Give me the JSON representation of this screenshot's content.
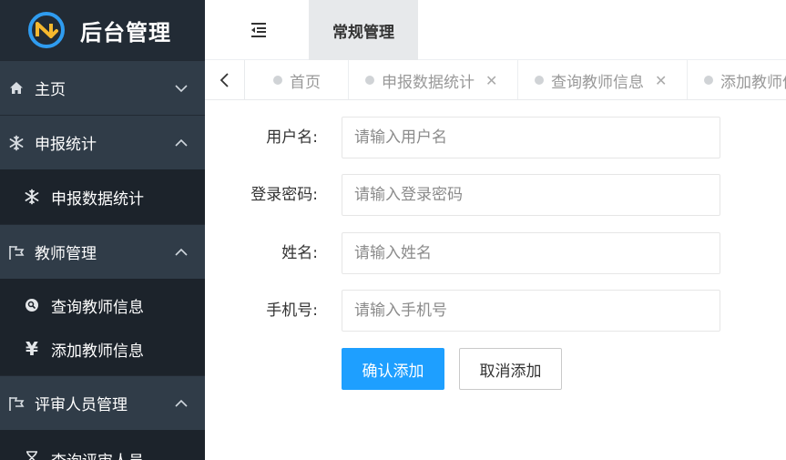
{
  "app": {
    "title": "后台管理"
  },
  "colors": {
    "sidebar": "#28323d",
    "sidebar_dark": "#1c232b",
    "primary": "#1e9fff"
  },
  "sidebar": {
    "groups": [
      {
        "label": "主页",
        "icon": "home-icon",
        "expanded": false
      },
      {
        "label": "申报统计",
        "icon": "snowflake-icon",
        "expanded": true,
        "items": [
          {
            "label": "申报数据统计",
            "icon": "snowflake-icon"
          }
        ]
      },
      {
        "label": "教师管理",
        "icon": "flag-icon",
        "expanded": true,
        "items": [
          {
            "label": "查询教师信息",
            "icon": "search-circle-icon"
          },
          {
            "label": "添加教师信息",
            "icon": "yen-icon"
          }
        ]
      },
      {
        "label": "评审人员管理",
        "icon": "flag-icon",
        "expanded": true,
        "items": [
          {
            "label": "查询评审人员",
            "icon": "hourglass-icon"
          }
        ]
      }
    ]
  },
  "topbar": {
    "tab_label": "常规管理",
    "toggle_icon": "indent-icon"
  },
  "tabs": [
    {
      "label": "首页",
      "closable": false
    },
    {
      "label": "申报数据统计",
      "closable": true
    },
    {
      "label": "查询教师信息",
      "closable": true
    },
    {
      "label": "添加教师信息",
      "closable": false
    }
  ],
  "form": {
    "fields": [
      {
        "label": "用户名:",
        "placeholder": "请输入用户名",
        "value": ""
      },
      {
        "label": "登录密码:",
        "placeholder": "请输入登录密码",
        "value": ""
      },
      {
        "label": "姓名:",
        "placeholder": "请输入姓名",
        "value": ""
      },
      {
        "label": "手机号:",
        "placeholder": "请输入手机号",
        "value": ""
      }
    ],
    "confirm_label": "确认添加",
    "cancel_label": "取消添加"
  }
}
